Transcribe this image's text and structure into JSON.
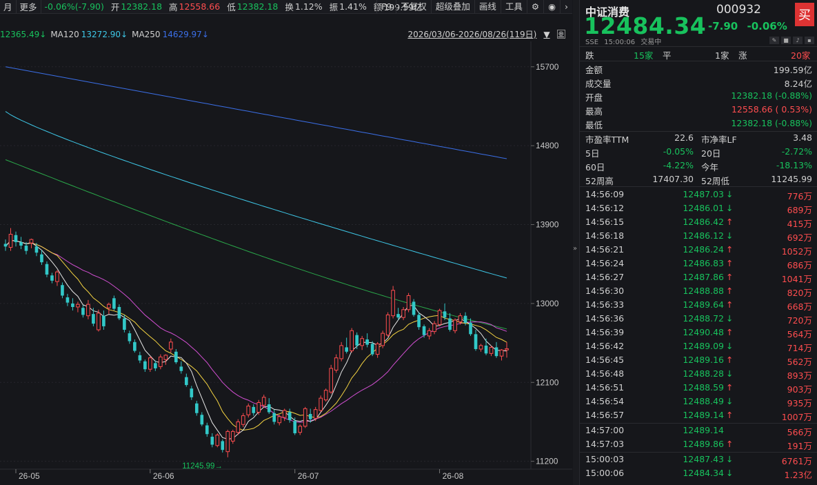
{
  "toolbar": {
    "period": "月",
    "more": "更多",
    "chg": "-0.06%(-7.90)",
    "open_lbl": "开",
    "open": "12382.18",
    "high_lbl": "高",
    "high": "12558.66",
    "low_lbl": "低",
    "low": "12382.18",
    "turn_lbl": "换",
    "turn": "1.12%",
    "amp_lbl": "振",
    "amp": "1.41%",
    "amt_lbl": "额",
    "amt": "199.59亿",
    "btn_f9": "F9",
    "btn_nofq": "不复权",
    "btn_overlay": "超级叠加",
    "btn_draw": "画线",
    "btn_tools": "工具"
  },
  "legend": {
    "ma_a": "12365.49↓",
    "ma120_lbl": "MA120",
    "ma120": "13272.90↓",
    "ma250_lbl": "MA250",
    "ma250": "14629.97↓",
    "date_range": "2026/03/06-2026/08/26(119日)"
  },
  "chart_data": {
    "type": "candlestick",
    "y_ticks": [
      "15700",
      "14800",
      "13900",
      "13000",
      "12100",
      "11200"
    ],
    "x_ticks": [
      "26-05",
      "26-06",
      "26-07",
      "26-08"
    ],
    "low_marker": "11245.99",
    "ylim": [
      11150,
      15950
    ],
    "ohlc": [
      [
        13680,
        13730,
        13600,
        13650
      ],
      [
        13640,
        13860,
        13600,
        13790
      ],
      [
        13780,
        13820,
        13650,
        13700
      ],
      [
        13700,
        13760,
        13620,
        13660
      ],
      [
        13660,
        13700,
        13560,
        13600
      ],
      [
        13690,
        13740,
        13630,
        13730
      ],
      [
        13650,
        13690,
        13540,
        13580
      ],
      [
        13560,
        13610,
        13440,
        13470
      ],
      [
        13450,
        13480,
        13300,
        13330
      ],
      [
        13320,
        13350,
        13230,
        13260
      ],
      [
        13250,
        13380,
        13200,
        13360
      ],
      [
        13210,
        13240,
        13060,
        13090
      ],
      [
        13070,
        13110,
        12970,
        13010
      ],
      [
        13000,
        13060,
        12920,
        12960
      ],
      [
        12960,
        13020,
        12900,
        12990
      ],
      [
        12950,
        12980,
        12840,
        12870
      ],
      [
        12860,
        13040,
        12820,
        12990
      ],
      [
        12880,
        12950,
        12740,
        12770
      ],
      [
        12700,
        12930,
        12680,
        12890
      ],
      [
        12860,
        12920,
        12700,
        12740
      ],
      [
        12950,
        13010,
        12880,
        12990
      ],
      [
        13060,
        13090,
        12920,
        12940
      ],
      [
        12960,
        12990,
        12810,
        12830
      ],
      [
        12830,
        12870,
        12670,
        12700
      ],
      [
        12660,
        12690,
        12540,
        12570
      ],
      [
        12560,
        12590,
        12440,
        12460
      ],
      [
        12410,
        12450,
        12320,
        12350
      ],
      [
        12340,
        12360,
        12220,
        12250
      ],
      [
        12250,
        12400,
        12220,
        12380
      ],
      [
        12320,
        12350,
        12230,
        12260
      ],
      [
        12280,
        12420,
        12250,
        12390
      ],
      [
        12360,
        12420,
        12300,
        12410
      ],
      [
        12480,
        12600,
        12440,
        12560
      ],
      [
        12450,
        12480,
        12310,
        12330
      ],
      [
        12280,
        12340,
        12200,
        12230
      ],
      [
        12160,
        12200,
        12050,
        12070
      ],
      [
        12030,
        12060,
        11900,
        11930
      ],
      [
        11860,
        11890,
        11720,
        11750
      ],
      [
        11730,
        11760,
        11600,
        11620
      ],
      [
        11610,
        11640,
        11480,
        11510
      ],
      [
        11480,
        11520,
        11360,
        11390
      ],
      [
        11380,
        11520,
        11360,
        11500
      ],
      [
        11430,
        11450,
        11300,
        11330
      ],
      [
        11310,
        11560,
        11246,
        11540
      ],
      [
        11430,
        11560,
        11400,
        11540
      ],
      [
        11530,
        11680,
        11500,
        11650
      ],
      [
        11620,
        11750,
        11590,
        11720
      ],
      [
        11730,
        11860,
        11700,
        11830
      ],
      [
        11820,
        11850,
        11720,
        11750
      ],
      [
        11760,
        11900,
        11730,
        11870
      ],
      [
        11840,
        11960,
        11810,
        11930
      ],
      [
        11850,
        11920,
        11740,
        11760
      ],
      [
        11750,
        11790,
        11620,
        11650
      ],
      [
        11640,
        11730,
        11610,
        11710
      ],
      [
        11700,
        11800,
        11660,
        11780
      ],
      [
        11760,
        11800,
        11640,
        11670
      ],
      [
        11660,
        11700,
        11500,
        11520
      ],
      [
        11530,
        11620,
        11500,
        11600
      ],
      [
        11600,
        11820,
        11580,
        11800
      ],
      [
        11740,
        11800,
        11640,
        11680
      ],
      [
        11690,
        11820,
        11660,
        11790
      ],
      [
        11780,
        11950,
        11760,
        11920
      ],
      [
        11900,
        12030,
        11880,
        12010
      ],
      [
        11990,
        12300,
        11970,
        12260
      ],
      [
        12240,
        12420,
        12210,
        12380
      ],
      [
        12370,
        12560,
        12340,
        12520
      ],
      [
        12500,
        12610,
        12430,
        12450
      ],
      [
        12460,
        12720,
        12440,
        12690
      ],
      [
        12640,
        12670,
        12480,
        12520
      ],
      [
        12520,
        12630,
        12470,
        12600
      ],
      [
        12590,
        12660,
        12500,
        12530
      ],
      [
        12540,
        12570,
        12400,
        12420
      ],
      [
        12420,
        12560,
        12380,
        12540
      ],
      [
        12520,
        12690,
        12490,
        12660
      ],
      [
        12640,
        12900,
        12620,
        12870
      ],
      [
        12860,
        13200,
        12830,
        13150
      ],
      [
        12880,
        12950,
        12810,
        12840
      ],
      [
        12840,
        12960,
        12810,
        12930
      ],
      [
        12930,
        13120,
        12900,
        13090
      ],
      [
        13020,
        13050,
        12850,
        12870
      ],
      [
        12870,
        12900,
        12700,
        12730
      ],
      [
        12740,
        12760,
        12610,
        12640
      ],
      [
        12630,
        12720,
        12590,
        12690
      ],
      [
        12680,
        12800,
        12650,
        12770
      ],
      [
        12760,
        12940,
        12740,
        12920
      ],
      [
        12910,
        13000,
        12810,
        12840
      ],
      [
        12830,
        12890,
        12680,
        12700
      ],
      [
        12690,
        12830,
        12660,
        12810
      ],
      [
        12790,
        12890,
        12760,
        12860
      ],
      [
        12860,
        12900,
        12750,
        12780
      ],
      [
        12780,
        12830,
        12630,
        12650
      ],
      [
        12650,
        12700,
        12460,
        12480
      ],
      [
        12480,
        12540,
        12450,
        12520
      ],
      [
        12520,
        12600,
        12410,
        12430
      ],
      [
        12430,
        12520,
        12400,
        12500
      ],
      [
        12500,
        12560,
        12380,
        12400
      ],
      [
        12400,
        12480,
        12350,
        12470
      ],
      [
        12470,
        12560,
        12382,
        12484
      ]
    ]
  },
  "quote": {
    "name": "中证消费",
    "code": "000932",
    "buy": "买",
    "price": "12484.34",
    "change": "-7.90",
    "pct": "-0.06%",
    "exch": "SSE",
    "time": "15:00:06",
    "status": "交易中",
    "fall_lbl": "跌",
    "fall": "15家",
    "flat_lbl": "平",
    "flat": "1家",
    "rise_lbl": "涨",
    "rise": "20家",
    "stats": [
      {
        "label": "金额",
        "value": "199.59亿"
      },
      {
        "label": "成交量",
        "value": "8.24亿"
      },
      {
        "label": "开盘",
        "value": "12382.18 (-0.88%)"
      },
      {
        "label": "最高",
        "value": "12558.66 ( 0.53%)"
      },
      {
        "label": "最低",
        "value": "12382.18 (-0.88%)"
      }
    ],
    "pe_lbl": "市盈率TTM",
    "pe": "22.6",
    "pb_lbl": "市净率LF",
    "pb": "3.48",
    "d5_lbl": "5日",
    "d5": "-0.05%",
    "d20_lbl": "20日",
    "d20": "-2.72%",
    "d60_lbl": "60日",
    "d60": "-4.22%",
    "ytd_lbl": "今年",
    "ytd": "-18.13%",
    "h52_lbl": "52周高",
    "h52": "17407.30",
    "l52_lbl": "52周低",
    "l52": "11245.99"
  },
  "trades": [
    {
      "t": "14:56:09",
      "p": "12487.03",
      "d": "↓",
      "v": "776万"
    },
    {
      "t": "14:56:12",
      "p": "12486.01",
      "d": "↓",
      "v": "689万"
    },
    {
      "t": "14:56:15",
      "p": "12486.42",
      "d": "↑",
      "v": "415万"
    },
    {
      "t": "14:56:18",
      "p": "12486.12",
      "d": "↓",
      "v": "692万"
    },
    {
      "t": "14:56:21",
      "p": "12486.24",
      "d": "↑",
      "v": "1052万"
    },
    {
      "t": "14:56:24",
      "p": "12486.83",
      "d": "↑",
      "v": "686万"
    },
    {
      "t": "14:56:27",
      "p": "12487.86",
      "d": "↑",
      "v": "1041万"
    },
    {
      "t": "14:56:30",
      "p": "12488.88",
      "d": "↑",
      "v": "820万"
    },
    {
      "t": "14:56:33",
      "p": "12489.64",
      "d": "↑",
      "v": "668万"
    },
    {
      "t": "14:56:36",
      "p": "12488.72",
      "d": "↓",
      "v": "720万"
    },
    {
      "t": "14:56:39",
      "p": "12490.48",
      "d": "↑",
      "v": "564万"
    },
    {
      "t": "14:56:42",
      "p": "12489.09",
      "d": "↓",
      "v": "714万"
    },
    {
      "t": "14:56:45",
      "p": "12489.16",
      "d": "↑",
      "v": "562万"
    },
    {
      "t": "14:56:48",
      "p": "12488.28",
      "d": "↓",
      "v": "893万"
    },
    {
      "t": "14:56:51",
      "p": "12488.59",
      "d": "↑",
      "v": "903万"
    },
    {
      "t": "14:56:54",
      "p": "12488.49",
      "d": "↓",
      "v": "935万"
    },
    {
      "t": "14:56:57",
      "p": "12489.14",
      "d": "↑",
      "v": "1007万"
    },
    {
      "t": "14:57:00",
      "p": "12489.14",
      "d": "",
      "v": "566万"
    },
    {
      "t": "14:57:03",
      "p": "12489.86",
      "d": "↑",
      "v": "191万"
    },
    {
      "t": "15:00:03",
      "p": "12487.43",
      "d": "↓",
      "v": "6761万"
    },
    {
      "t": "15:00:06",
      "p": "12484.34",
      "d": "↓",
      "v": "1.23亿"
    }
  ],
  "colors": {
    "up": "#ff4d4f",
    "down": "#18c25d",
    "ma5": "#e8e8e8",
    "ma10": "#f5d442",
    "ma20": "#d24fd2",
    "ma60": "#2aa84a",
    "ma120": "#3ec8e8",
    "ma250": "#3b6fe8"
  }
}
